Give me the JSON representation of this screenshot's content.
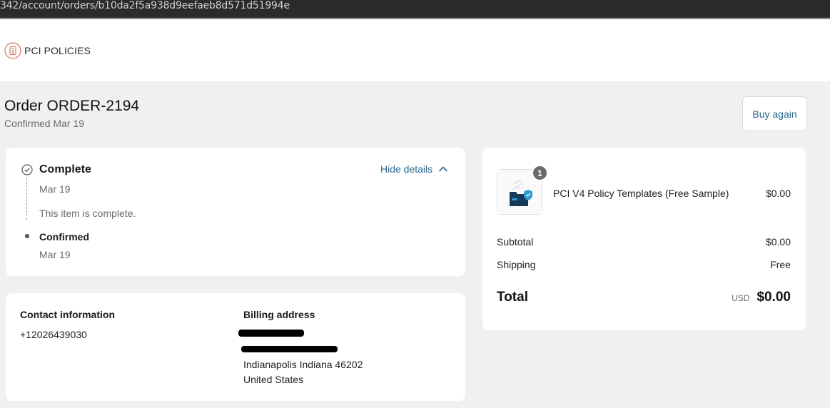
{
  "browser": {
    "url": "342/account/orders/b10da2f5a938d9eefaeb8d571d51994e"
  },
  "header": {
    "brand": "PCI POLICIES",
    "logo_icon": "document-icon"
  },
  "order": {
    "title": "Order ORDER-2194",
    "subtitle": "Confirmed Mar 19",
    "buy_again_label": "Buy again"
  },
  "status": {
    "complete_label": "Complete",
    "complete_date": "Mar 19",
    "complete_desc": "This item is complete.",
    "confirmed_label": "Confirmed",
    "confirmed_date": "Mar 19",
    "hide_details_label": "Hide details"
  },
  "contact": {
    "heading": "Contact information",
    "phone": "+12026439030"
  },
  "billing": {
    "heading": "Billing address",
    "city_line": "Indianapolis Indiana 46202",
    "country": "United States"
  },
  "summary": {
    "items": [
      {
        "qty": "1",
        "name": "PCI V4 Policy Templates (Free Sample)",
        "price": "$0.00"
      }
    ],
    "subtotal_label": "Subtotal",
    "subtotal_value": "$0.00",
    "shipping_label": "Shipping",
    "shipping_value": "Free",
    "total_label": "Total",
    "currency": "USD",
    "total_value": "$0.00"
  },
  "colors": {
    "accent": "#2a6a8e",
    "brand_logo": "#d9795a",
    "page_bg": "#f0f0f0"
  }
}
